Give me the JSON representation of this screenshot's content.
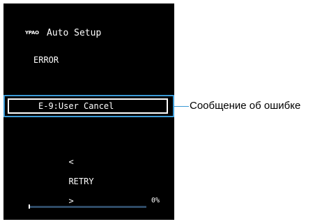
{
  "screen": {
    "logo": "YPAO",
    "title": "Auto Setup",
    "status": "ERROR",
    "error_message": "E-9:User Cancel",
    "retry": {
      "left_arrow": "<",
      "label": "RETRY",
      "right_arrow": ">"
    },
    "progress": {
      "value_percent": 0,
      "label": "0%"
    }
  },
  "annotation": {
    "callout": "Сообщение об ошибке"
  },
  "colors": {
    "screen_bg": "#000000",
    "highlight": "#3b9ad6",
    "text": "#ffffff",
    "progress_track": "#2e4a66"
  }
}
